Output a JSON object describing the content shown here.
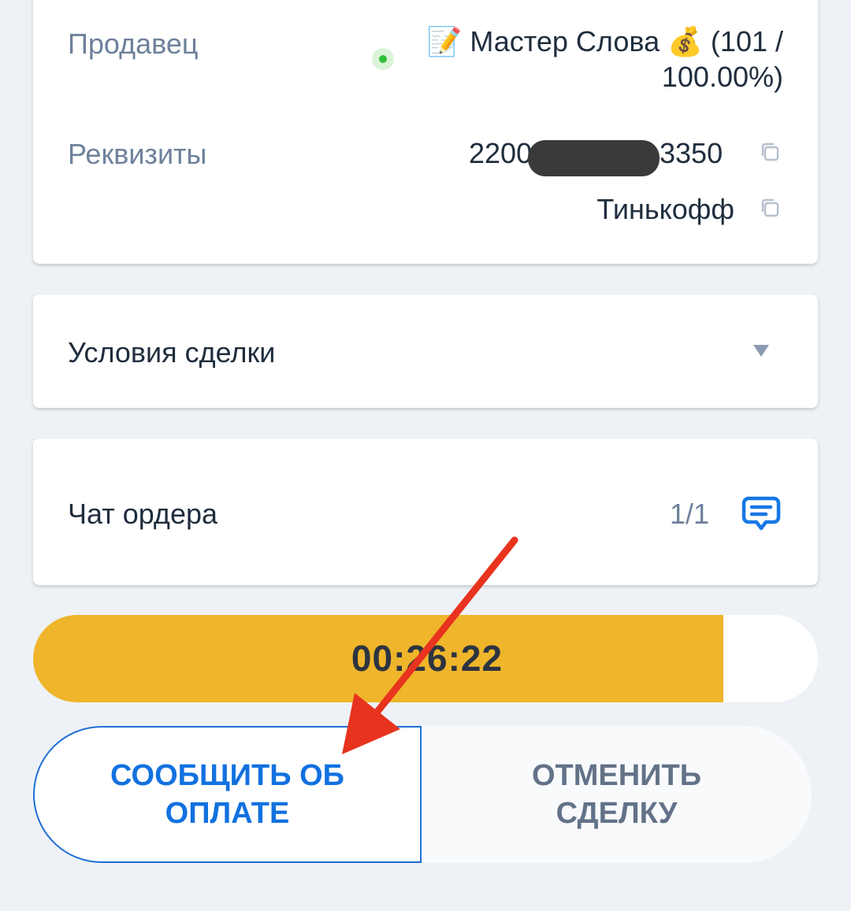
{
  "seller": {
    "label": "Продавец",
    "name": "📝 Мастер Слова 💰 (101 / 100.00%)",
    "online_color": "#2fbf3a"
  },
  "requisites": {
    "label": "Реквизиты",
    "card_start": "2200",
    "card_end": "3350",
    "bank": "Тинькофф"
  },
  "terms": {
    "label": "Условия сделки",
    "icon": "chevron-down-icon"
  },
  "chat": {
    "label": "Чат ордера",
    "count": "1/1",
    "icon": "chat-icon"
  },
  "timer": {
    "value": "00:26:22",
    "remaining_fraction": 0.88,
    "color": "#efb52b"
  },
  "actions": {
    "pay_label": "СООБЩИТЬ ОБ ОПЛАТЕ",
    "cancel_label": "ОТМЕНИТЬ СДЕЛКУ"
  },
  "colors": {
    "accent": "#1271e0",
    "annotation_arrow": "#e8331e"
  }
}
